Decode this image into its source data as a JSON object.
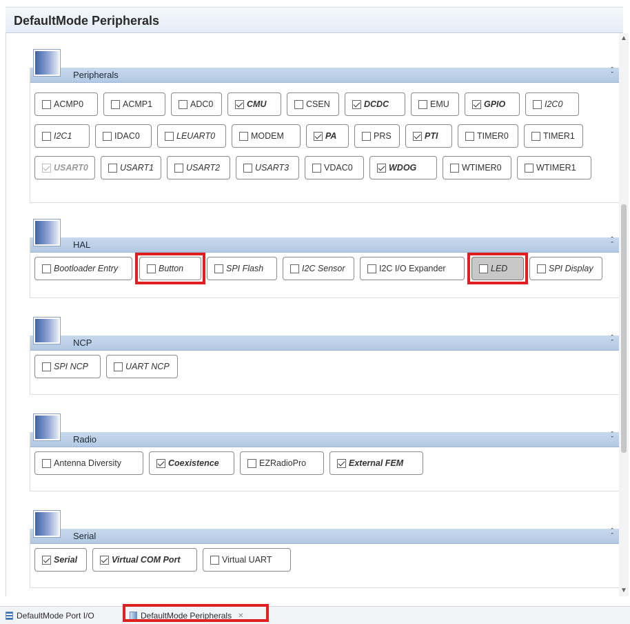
{
  "window": {
    "title": "DefaultMode Peripherals"
  },
  "sections": [
    {
      "title": "Peripherals",
      "collapse_icon": "double-chevron-up",
      "rows": [
        [
          {
            "label": "ACMP0",
            "checked": false,
            "style": "normal"
          },
          {
            "label": "ACMP1",
            "checked": false,
            "style": "normal"
          },
          {
            "label": "ADC0",
            "checked": false,
            "style": "normal"
          },
          {
            "label": "CMU",
            "checked": true,
            "style": "bold-italic"
          },
          {
            "label": "CSEN",
            "checked": false,
            "style": "normal"
          },
          {
            "label": "DCDC",
            "checked": true,
            "style": "bold-italic"
          },
          {
            "label": "EMU",
            "checked": false,
            "style": "normal"
          },
          {
            "label": "GPIO",
            "checked": true,
            "style": "bold-italic"
          },
          {
            "label": "I2C0",
            "checked": false,
            "style": "italic"
          }
        ],
        [
          {
            "label": "I2C1",
            "checked": false,
            "style": "italic"
          },
          {
            "label": "IDAC0",
            "checked": false,
            "style": "normal"
          },
          {
            "label": "LEUART0",
            "checked": false,
            "style": "italic"
          },
          {
            "label": "MODEM",
            "checked": false,
            "style": "normal"
          },
          {
            "label": "PA",
            "checked": true,
            "style": "bold-italic"
          },
          {
            "label": "PRS",
            "checked": false,
            "style": "normal"
          },
          {
            "label": "PTI",
            "checked": true,
            "style": "bold-italic"
          },
          {
            "label": "TIMER0",
            "checked": false,
            "style": "normal"
          },
          {
            "label": "TIMER1",
            "checked": false,
            "style": "normal"
          }
        ],
        [
          {
            "label": "USART0",
            "checked": true,
            "style": "bold-italic",
            "disabled": true
          },
          {
            "label": "USART1",
            "checked": false,
            "style": "italic"
          },
          {
            "label": "USART2",
            "checked": false,
            "style": "italic"
          },
          {
            "label": "USART3",
            "checked": false,
            "style": "italic"
          },
          {
            "label": "VDAC0",
            "checked": false,
            "style": "normal"
          },
          {
            "label": "WDOG",
            "checked": true,
            "style": "bold-italic"
          },
          {
            "label": "WTIMER0",
            "checked": false,
            "style": "normal"
          },
          {
            "label": "WTIMER1",
            "checked": false,
            "style": "normal"
          }
        ]
      ]
    },
    {
      "title": "HAL",
      "collapse_icon": "double-chevron-up",
      "rows": [
        [
          {
            "label": "Bootloader Entry",
            "checked": false,
            "style": "italic"
          },
          {
            "label": "Button",
            "checked": false,
            "style": "italic",
            "highlighted": true
          },
          {
            "label": "SPI Flash",
            "checked": false,
            "style": "italic"
          },
          {
            "label": "I2C Sensor",
            "checked": false,
            "style": "italic"
          },
          {
            "label": "I2C I/O Expander",
            "checked": false,
            "style": "normal"
          },
          {
            "label": "LED",
            "checked": false,
            "style": "italic",
            "highlighted": true,
            "greyed": true
          },
          {
            "label": "SPI Display",
            "checked": false,
            "style": "italic"
          }
        ]
      ]
    },
    {
      "title": "NCP",
      "collapse_icon": "double-chevron-up",
      "rows": [
        [
          {
            "label": "SPI NCP",
            "checked": false,
            "style": "italic"
          },
          {
            "label": "UART NCP",
            "checked": false,
            "style": "italic"
          }
        ]
      ]
    },
    {
      "title": "Radio",
      "collapse_icon": "double-chevron-up",
      "rows": [
        [
          {
            "label": "Antenna Diversity",
            "checked": false,
            "style": "normal"
          },
          {
            "label": "Coexistence",
            "checked": true,
            "style": "bold-italic"
          },
          {
            "label": "EZRadioPro",
            "checked": false,
            "style": "normal"
          },
          {
            "label": "External FEM",
            "checked": true,
            "style": "bold-italic"
          }
        ]
      ]
    },
    {
      "title": "Serial",
      "collapse_icon": "double-chevron-up",
      "rows": [
        [
          {
            "label": "Serial",
            "checked": true,
            "style": "bold-italic"
          },
          {
            "label": "Virtual COM Port",
            "checked": true,
            "style": "bold-italic"
          },
          {
            "label": "Virtual UART",
            "checked": false,
            "style": "normal"
          }
        ]
      ]
    }
  ],
  "tabs": [
    {
      "label": "DefaultMode Port I/O",
      "icon": "port-io-icon",
      "active": false,
      "closable": false
    },
    {
      "label": "DefaultMode Peripherals",
      "icon": "peripherals-icon",
      "active": true,
      "closable": true,
      "highlighted": true
    }
  ],
  "colors": {
    "highlight": "#e02020",
    "section_header": "#b3c9e3",
    "greyed_chip": "#c8c8c8"
  }
}
